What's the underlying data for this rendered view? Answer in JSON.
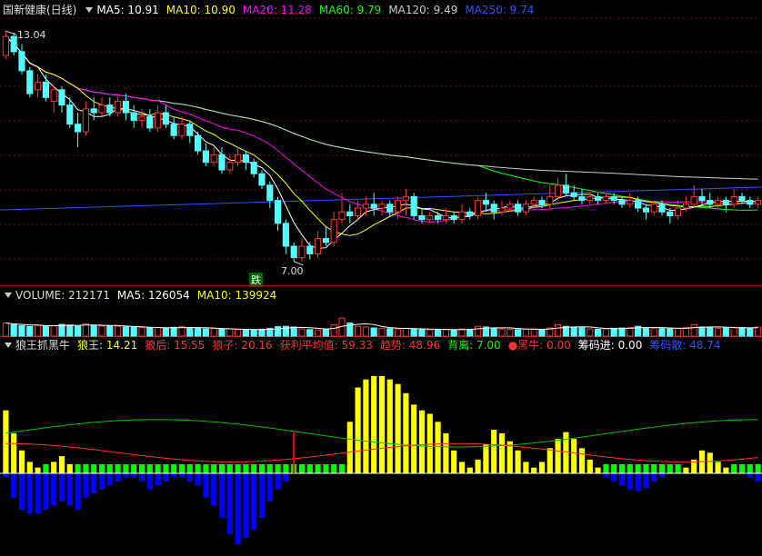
{
  "main_header": {
    "stock_name": "国新健康(日线)",
    "ma5": "MA5: 10.91",
    "ma10": "MA10: 10.90",
    "ma20": "MA20: 11.28",
    "ma60": "MA60: 9.79",
    "ma120": "MA120: 9.49",
    "ma250": "MA250: 9.74"
  },
  "high_label": "13.04",
  "low_label": "7.00",
  "signal_marker": "跌",
  "volume_header": {
    "volume": "VOLUME: 212171",
    "ma5": "MA5: 126054",
    "ma10": "MA10: 139924"
  },
  "indicator_header": {
    "name": "狼王抓黑牛",
    "wolf_king": "狼王: 14.21",
    "wolf_queen": "狼后: 15.55",
    "wolf_cub": "狼子: 20.16",
    "avg_profit": "获利平均值: 59.33",
    "trend": "趋势: 48.96",
    "divergence": "背离: 7.00",
    "black_bull": "●黑牛: 0.00",
    "chips_in": "筹码进: 0.00",
    "chips_ratio": "筹码散: 48.74"
  },
  "colors": {
    "up": "#ff3232",
    "down": "#54ffff",
    "ma5": "#ffffff",
    "ma10": "#ffff00",
    "ma20": "#ff00ff",
    "ma60": "#00ff00",
    "ma120": "#cccccc",
    "ma250": "#3050ff",
    "yellow_bar": "#ffff00",
    "blue_bar": "#0000ff",
    "green_bar": "#00ff00"
  },
  "chart_data": {
    "type": "candlestick",
    "price_high": 13.04,
    "price_low": 7.0,
    "candles": [
      [
        12.4,
        12.9,
        13.04,
        12.3
      ],
      [
        12.9,
        12.5,
        13.0,
        12.4
      ],
      [
        12.5,
        12.0,
        12.7,
        11.9
      ],
      [
        12.0,
        11.4,
        12.1,
        11.3
      ],
      [
        11.5,
        11.7,
        11.9,
        11.3
      ],
      [
        11.7,
        11.3,
        11.9,
        11.2
      ],
      [
        11.2,
        11.5,
        11.6,
        10.9
      ],
      [
        11.5,
        11.1,
        11.6,
        10.9
      ],
      [
        11.1,
        10.6,
        11.3,
        10.5
      ],
      [
        10.6,
        10.4,
        10.9,
        10.0
      ],
      [
        10.4,
        11.0,
        11.2,
        10.3
      ],
      [
        11.0,
        10.9,
        11.3,
        10.7
      ],
      [
        10.9,
        11.1,
        11.3,
        10.8
      ],
      [
        11.1,
        10.9,
        11.3,
        10.8
      ],
      [
        10.9,
        11.2,
        11.4,
        10.8
      ],
      [
        11.2,
        10.9,
        11.4,
        10.7
      ],
      [
        10.9,
        10.7,
        11.1,
        10.5
      ],
      [
        10.7,
        10.8,
        11.0,
        10.5
      ],
      [
        10.8,
        10.5,
        11.0,
        10.4
      ],
      [
        10.5,
        10.9,
        11.1,
        10.4
      ],
      [
        10.9,
        10.6,
        11.1,
        10.5
      ],
      [
        10.6,
        10.3,
        10.8,
        10.2
      ],
      [
        10.3,
        10.6,
        10.8,
        10.2
      ],
      [
        10.6,
        10.3,
        10.7,
        10.1
      ],
      [
        10.3,
        9.9,
        10.4,
        9.8
      ],
      [
        9.9,
        9.6,
        10.1,
        9.5
      ],
      [
        9.6,
        9.8,
        10.0,
        9.5
      ],
      [
        9.8,
        9.4,
        10.0,
        9.3
      ],
      [
        9.4,
        9.6,
        9.8,
        9.3
      ],
      [
        9.6,
        9.8,
        10.0,
        9.5
      ],
      [
        9.8,
        9.6,
        9.9,
        9.4
      ],
      [
        9.6,
        9.3,
        9.7,
        9.2
      ],
      [
        9.3,
        9.0,
        9.4,
        8.9
      ],
      [
        9.0,
        8.6,
        9.1,
        8.4
      ],
      [
        8.6,
        8.0,
        8.7,
        7.8
      ],
      [
        8.0,
        7.4,
        8.1,
        7.2
      ],
      [
        7.4,
        7.1,
        7.5,
        7.0
      ],
      [
        7.1,
        7.4,
        7.6,
        7.0
      ],
      [
        7.4,
        7.2,
        7.5,
        7.05
      ],
      [
        7.2,
        7.6,
        7.8,
        7.1
      ],
      [
        7.6,
        7.5,
        7.9,
        7.4
      ],
      [
        7.5,
        8.1,
        8.3,
        7.4
      ],
      [
        8.1,
        8.3,
        8.8,
        8.0
      ],
      [
        8.3,
        8.2,
        8.5,
        8.0
      ],
      [
        8.2,
        8.4,
        8.6,
        8.1
      ],
      [
        8.4,
        8.5,
        8.7,
        8.2
      ],
      [
        8.5,
        8.4,
        8.8,
        8.2
      ],
      [
        8.4,
        8.5,
        8.6,
        8.2
      ],
      [
        8.5,
        8.3,
        8.6,
        8.2
      ],
      [
        8.3,
        8.6,
        8.7,
        8.1
      ],
      [
        8.6,
        8.7,
        8.9,
        8.2
      ],
      [
        8.7,
        8.2,
        8.8,
        8.1
      ],
      [
        8.2,
        8.1,
        8.4,
        8.0
      ],
      [
        8.1,
        8.2,
        8.3,
        8.0
      ],
      [
        8.2,
        8.1,
        8.3,
        8.0
      ],
      [
        8.1,
        8.2,
        8.4,
        8.0
      ],
      [
        8.2,
        8.1,
        8.3,
        8.0
      ],
      [
        8.1,
        8.3,
        8.5,
        8.0
      ],
      [
        8.3,
        8.2,
        8.4,
        8.1
      ],
      [
        8.2,
        8.6,
        8.7,
        8.1
      ],
      [
        8.6,
        8.5,
        8.8,
        8.3
      ],
      [
        8.5,
        8.3,
        8.6,
        8.1
      ],
      [
        8.3,
        8.4,
        8.6,
        8.2
      ],
      [
        8.4,
        8.5,
        8.6,
        8.3
      ],
      [
        8.5,
        8.3,
        8.6,
        8.2
      ],
      [
        8.3,
        8.5,
        8.6,
        8.2
      ],
      [
        8.5,
        8.6,
        8.7,
        8.4
      ],
      [
        8.6,
        8.5,
        8.7,
        8.4
      ],
      [
        8.5,
        8.7,
        9.0,
        8.4
      ],
      [
        8.7,
        9.0,
        9.2,
        8.6
      ],
      [
        9.0,
        8.8,
        9.3,
        8.7
      ],
      [
        8.8,
        8.7,
        9.0,
        8.6
      ],
      [
        8.7,
        8.6,
        8.9,
        8.5
      ],
      [
        8.6,
        8.7,
        8.8,
        8.5
      ],
      [
        8.7,
        8.6,
        8.8,
        8.5
      ],
      [
        8.6,
        8.7,
        8.8,
        8.5
      ],
      [
        8.7,
        8.6,
        8.8,
        8.5
      ],
      [
        8.6,
        8.5,
        8.7,
        8.4
      ],
      [
        8.5,
        8.6,
        8.8,
        8.4
      ],
      [
        8.6,
        8.4,
        8.7,
        8.3
      ],
      [
        8.4,
        8.3,
        8.5,
        8.1
      ],
      [
        8.3,
        8.5,
        8.6,
        8.2
      ],
      [
        8.5,
        8.3,
        8.6,
        8.2
      ],
      [
        8.3,
        8.2,
        8.4,
        8.0
      ],
      [
        8.2,
        8.4,
        8.6,
        8.1
      ],
      [
        8.4,
        8.5,
        8.7,
        8.3
      ],
      [
        8.5,
        8.7,
        9.0,
        8.4
      ],
      [
        8.7,
        8.6,
        8.9,
        8.5
      ],
      [
        8.6,
        8.5,
        8.8,
        8.4
      ],
      [
        8.5,
        8.6,
        8.7,
        8.4
      ],
      [
        8.6,
        8.5,
        8.7,
        8.3
      ],
      [
        8.5,
        8.7,
        8.9,
        8.4
      ],
      [
        8.7,
        8.6,
        8.8,
        8.5
      ],
      [
        8.6,
        8.5,
        8.7,
        8.4
      ],
      [
        8.5,
        8.6,
        8.7,
        8.4
      ]
    ],
    "ma250_endpoints": [
      8.35,
      8.95
    ],
    "volume_max": 212171,
    "volumes": [
      0.4,
      0.35,
      0.32,
      0.3,
      0.33,
      0.31,
      0.32,
      0.36,
      0.34,
      0.3,
      0.38,
      0.33,
      0.31,
      0.32,
      0.3,
      0.28,
      0.27,
      0.26,
      0.25,
      0.26,
      0.24,
      0.27,
      0.29,
      0.26,
      0.24,
      0.22,
      0.23,
      0.21,
      0.22,
      0.2,
      0.19,
      0.18,
      0.21,
      0.24,
      0.29,
      0.3,
      0.28,
      0.22,
      0.2,
      0.19,
      0.2,
      0.35,
      0.55,
      0.4,
      0.3,
      0.28,
      0.25,
      0.24,
      0.23,
      0.22,
      0.24,
      0.22,
      0.2,
      0.19,
      0.21,
      0.2,
      0.19,
      0.22,
      0.21,
      0.3,
      0.28,
      0.25,
      0.22,
      0.21,
      0.2,
      0.21,
      0.22,
      0.21,
      0.25,
      0.35,
      0.3,
      0.28,
      0.25,
      0.22,
      0.21,
      0.22,
      0.24,
      0.25,
      0.27,
      0.3,
      0.26,
      0.24,
      0.23,
      0.22,
      0.24,
      0.27,
      0.35,
      0.28,
      0.26,
      0.24,
      0.25,
      0.27,
      0.26,
      0.25,
      0.28
    ],
    "indicator_yellow": [
      0.55,
      0.35,
      0.2,
      0.1,
      0.05,
      0.0,
      0.1,
      0.15,
      0.08,
      0.0,
      0.0,
      0.0,
      0.0,
      0.0,
      0.0,
      0.0,
      0.0,
      0.0,
      0.0,
      0.0,
      0.0,
      0.0,
      0.0,
      0.0,
      0.0,
      0.0,
      0.0,
      0.0,
      0.0,
      0.0,
      0.0,
      0.0,
      0.0,
      0.0,
      0.0,
      0.0,
      0.0,
      0.0,
      0.0,
      0.0,
      0.0,
      0.0,
      0.0,
      0.45,
      0.75,
      0.82,
      0.85,
      0.85,
      0.82,
      0.78,
      0.7,
      0.6,
      0.55,
      0.52,
      0.45,
      0.35,
      0.2,
      0.1,
      0.05,
      0.12,
      0.25,
      0.38,
      0.35,
      0.28,
      0.2,
      0.1,
      0.05,
      0.1,
      0.22,
      0.3,
      0.36,
      0.3,
      0.22,
      0.12,
      0.05,
      0.0,
      0.0,
      0.0,
      0.0,
      0.0,
      0.0,
      0.0,
      0.0,
      0.0,
      0.0,
      0.05,
      0.12,
      0.2,
      0.18,
      0.1,
      0.05,
      0.0,
      0.0,
      0.0,
      0.0
    ],
    "indicator_blue": [
      -0.05,
      -0.3,
      -0.45,
      -0.5,
      -0.5,
      -0.45,
      -0.4,
      -0.35,
      -0.4,
      -0.45,
      -0.3,
      -0.25,
      -0.2,
      -0.15,
      -0.1,
      -0.05,
      -0.05,
      -0.1,
      -0.2,
      -0.15,
      -0.1,
      -0.05,
      -0.05,
      -0.1,
      -0.15,
      -0.3,
      -0.4,
      -0.55,
      -0.75,
      -0.88,
      -0.8,
      -0.7,
      -0.55,
      -0.35,
      -0.2,
      -0.1,
      0,
      0,
      0,
      0,
      0,
      0,
      0,
      0,
      0,
      0,
      0,
      0,
      0,
      0,
      0,
      0,
      0,
      0,
      0,
      0,
      0,
      0,
      0,
      0,
      0,
      0,
      0,
      0,
      0,
      0,
      0,
      0,
      0,
      0,
      0,
      0,
      0,
      0,
      0,
      -0.05,
      -0.1,
      -0.15,
      -0.2,
      -0.22,
      -0.18,
      -0.1,
      -0.05,
      0,
      0,
      0,
      0,
      0,
      0,
      0,
      0,
      0,
      0,
      -0.05,
      -0.1
    ]
  }
}
